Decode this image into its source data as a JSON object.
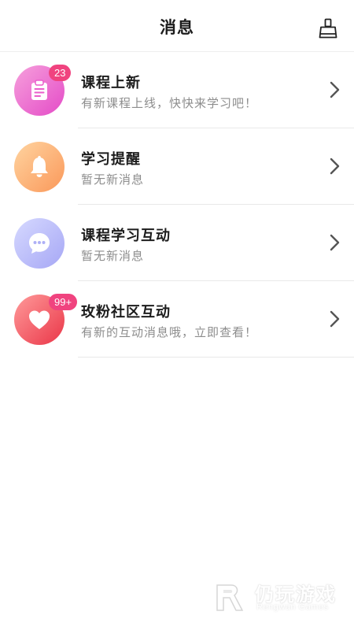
{
  "header": {
    "title": "消息",
    "clean_icon": "broom-icon"
  },
  "messages": [
    {
      "name": "课程上新",
      "desc": "有新课程上线，快快来学习吧！",
      "badge": "23",
      "icon": "clipboard-icon",
      "gradient": [
        "#f595d8",
        "#e94cc9"
      ]
    },
    {
      "name": "学习提醒",
      "desc": "暂无新消息",
      "badge": "",
      "icon": "bell-icon",
      "gradient": [
        "#ffcf9a",
        "#fb9c5e"
      ]
    },
    {
      "name": "课程学习互动",
      "desc": "暂无新消息",
      "badge": "",
      "icon": "chat-bubble-icon",
      "gradient": [
        "#cfd3ff",
        "#a9aaf6"
      ]
    },
    {
      "name": "玫粉社区互动",
      "desc": "有新的互动消息哦，立即查看！",
      "badge": "99+",
      "icon": "heart-icon",
      "gradient": [
        "#ff8f8f",
        "#ee3d4f"
      ]
    }
  ],
  "watermark": {
    "cn": "仍玩游戏",
    "en": "Rengwan Games"
  }
}
